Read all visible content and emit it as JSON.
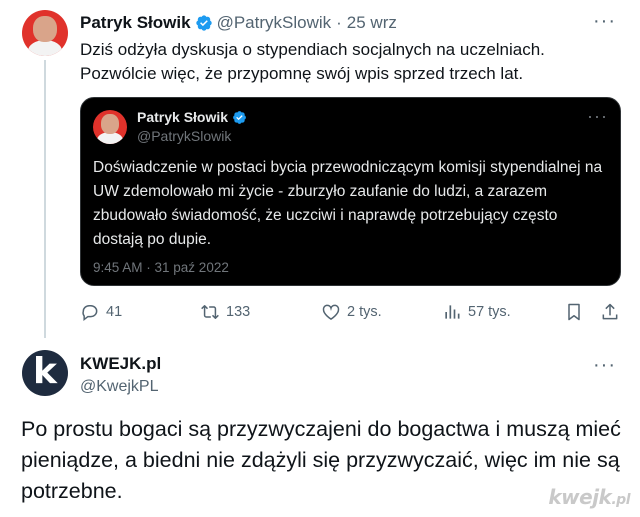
{
  "tweet": {
    "author_name": "Patryk Słowik",
    "handle": "@PatrykSlowik",
    "separator": "·",
    "date": "25 wrz",
    "more": "···",
    "text": "Dziś odżyła dyskusja o stypendiach socjalnych na uczelniach. Pozwólcie więc, że przypomnę swój wpis sprzed trzech lat.",
    "quote": {
      "author_name": "Patryk Słowik",
      "handle": "@PatrykSlowik",
      "more": "···",
      "text": "Doświadczenie w postaci bycia przewodniczącym komisji stypendialnej na UW zdemolowało mi życie - zburzyło zaufanie do ludzi, a zarazem zbudowało świadomość, że uczciwi i naprawdę potrzebujący często dostają po dupie.",
      "timestamp": "9:45 AM · 31 paź 2022"
    },
    "actions": {
      "replies": "41",
      "retweets": "133",
      "likes": "2 tys.",
      "views": "57 tys."
    }
  },
  "reply": {
    "avatar_letter": "k",
    "author_name": "KWEJK.pl",
    "handle": "@KwejkPL",
    "more": "···",
    "text": "Po prostu bogaci są przyzwyczajeni do bogactwa i muszą mieć pieniądze, a biedni nie zdążyli się przyzwyczaić, więc im nie są potrzebne."
  },
  "watermark": {
    "text": "kwejk",
    "suffix": ".pl"
  },
  "colors": {
    "verified": "#1d9bf0",
    "text_primary": "#0f1419",
    "text_secondary": "#536471",
    "quote_bg": "#000000",
    "avatar_red": "#e0322b",
    "kwejk_avatar": "#1e2b3f"
  },
  "icons": [
    "verified-badge-icon",
    "more-icon",
    "reply-icon",
    "retweet-icon",
    "like-icon",
    "views-icon",
    "bookmark-icon",
    "share-icon"
  ]
}
